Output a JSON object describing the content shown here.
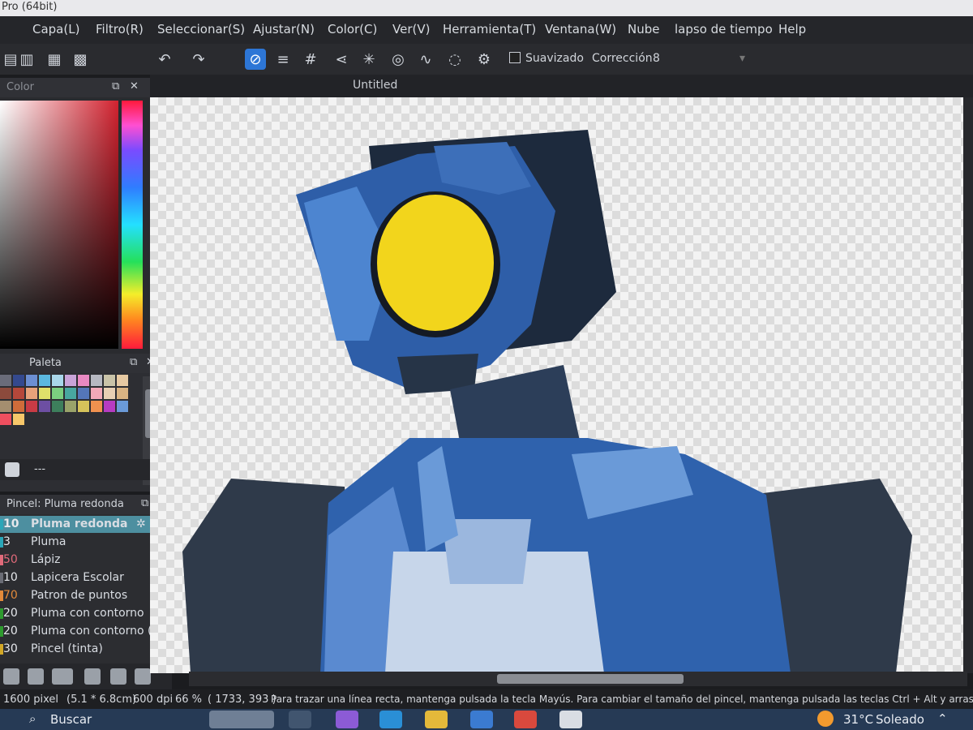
{
  "app": {
    "title": "Pro (64bit)"
  },
  "menu": [
    "Capa(L)",
    "Filtro(R)",
    "Seleccionar(S)",
    "Ajustar(N)",
    "Color(C)",
    "Ver(V)",
    "Herramienta(T)",
    "Ventana(W)",
    "Nube",
    "lapso de tiempo",
    "Help"
  ],
  "toolbar": {
    "smoothing_label": "Suavizado",
    "correction_label": "Corrección",
    "correction_value": "8"
  },
  "document": {
    "tab_title": "Untitled"
  },
  "color_panel": {
    "title": "Color"
  },
  "palette_panel": {
    "title": "Paleta",
    "footer_text": "---",
    "swatch_colors": [
      "#6a6c7a",
      "#34498e",
      "#6c8fd2",
      "#5bb8e0",
      "#a9d7ea",
      "#c9a3d8",
      "#e889c2",
      "#b6b8c1",
      "#c9c3a8",
      "#e6c9a2",
      "#8c4a3c",
      "#b5473a",
      "#e7a27a",
      "#e0e06a",
      "#7bcf7f",
      "#48a7a0",
      "#5476b8",
      "#f2a9b9",
      "#e7cfb3",
      "#d9b382",
      "#a48e6f",
      "#d06c3a",
      "#c93b45",
      "#6d4fa3",
      "#3d7f5c",
      "#9aa36a",
      "#d5c25a",
      "#f0914f",
      "#b63bc2",
      "#6a9ad8",
      "#ef4f5f",
      "#f7c76a"
    ]
  },
  "brush_panel": {
    "title": "Pincel: Pluma redonda",
    "items": [
      {
        "num": "10",
        "name": "Pluma redonda",
        "selected": true,
        "color": "#2aa6b8"
      },
      {
        "num": "3",
        "name": "Pluma",
        "selected": false,
        "color": "#2aa6b8"
      },
      {
        "num": "50",
        "name": "Lápiz",
        "selected": false,
        "color": "#e06a7a"
      },
      {
        "num": "10",
        "name": "Lapicera Escolar",
        "selected": false,
        "color": "#6a6c75"
      },
      {
        "num": "70",
        "name": "Patron de puntos",
        "selected": false,
        "color": "#e38a3a"
      },
      {
        "num": "20",
        "name": "Pluma con contorno",
        "selected": false,
        "color": "#2e9a2e"
      },
      {
        "num": "20",
        "name": "Pluma con contorno (s",
        "selected": false,
        "color": "#2e9a2e"
      },
      {
        "num": "30",
        "name": "Pincel (tinta)",
        "selected": false,
        "color": "#d2a726"
      }
    ]
  },
  "status": {
    "size": "1600 pixel",
    "physical": "(5.1 * 6.8cm)",
    "dpi": "600 dpi",
    "zoom": "66 %",
    "coords": "( 1733, 393 )",
    "hint": "Para trazar una línea recta, mantenga pulsada la tecla Mayús. Para cambiar el tamaño del pincel, mantenga pulsada las teclas Ctrl + Alt y arrastre"
  },
  "taskbar": {
    "search_label": "Buscar",
    "weather_temp": "31°C",
    "weather_text": "Soleado"
  }
}
